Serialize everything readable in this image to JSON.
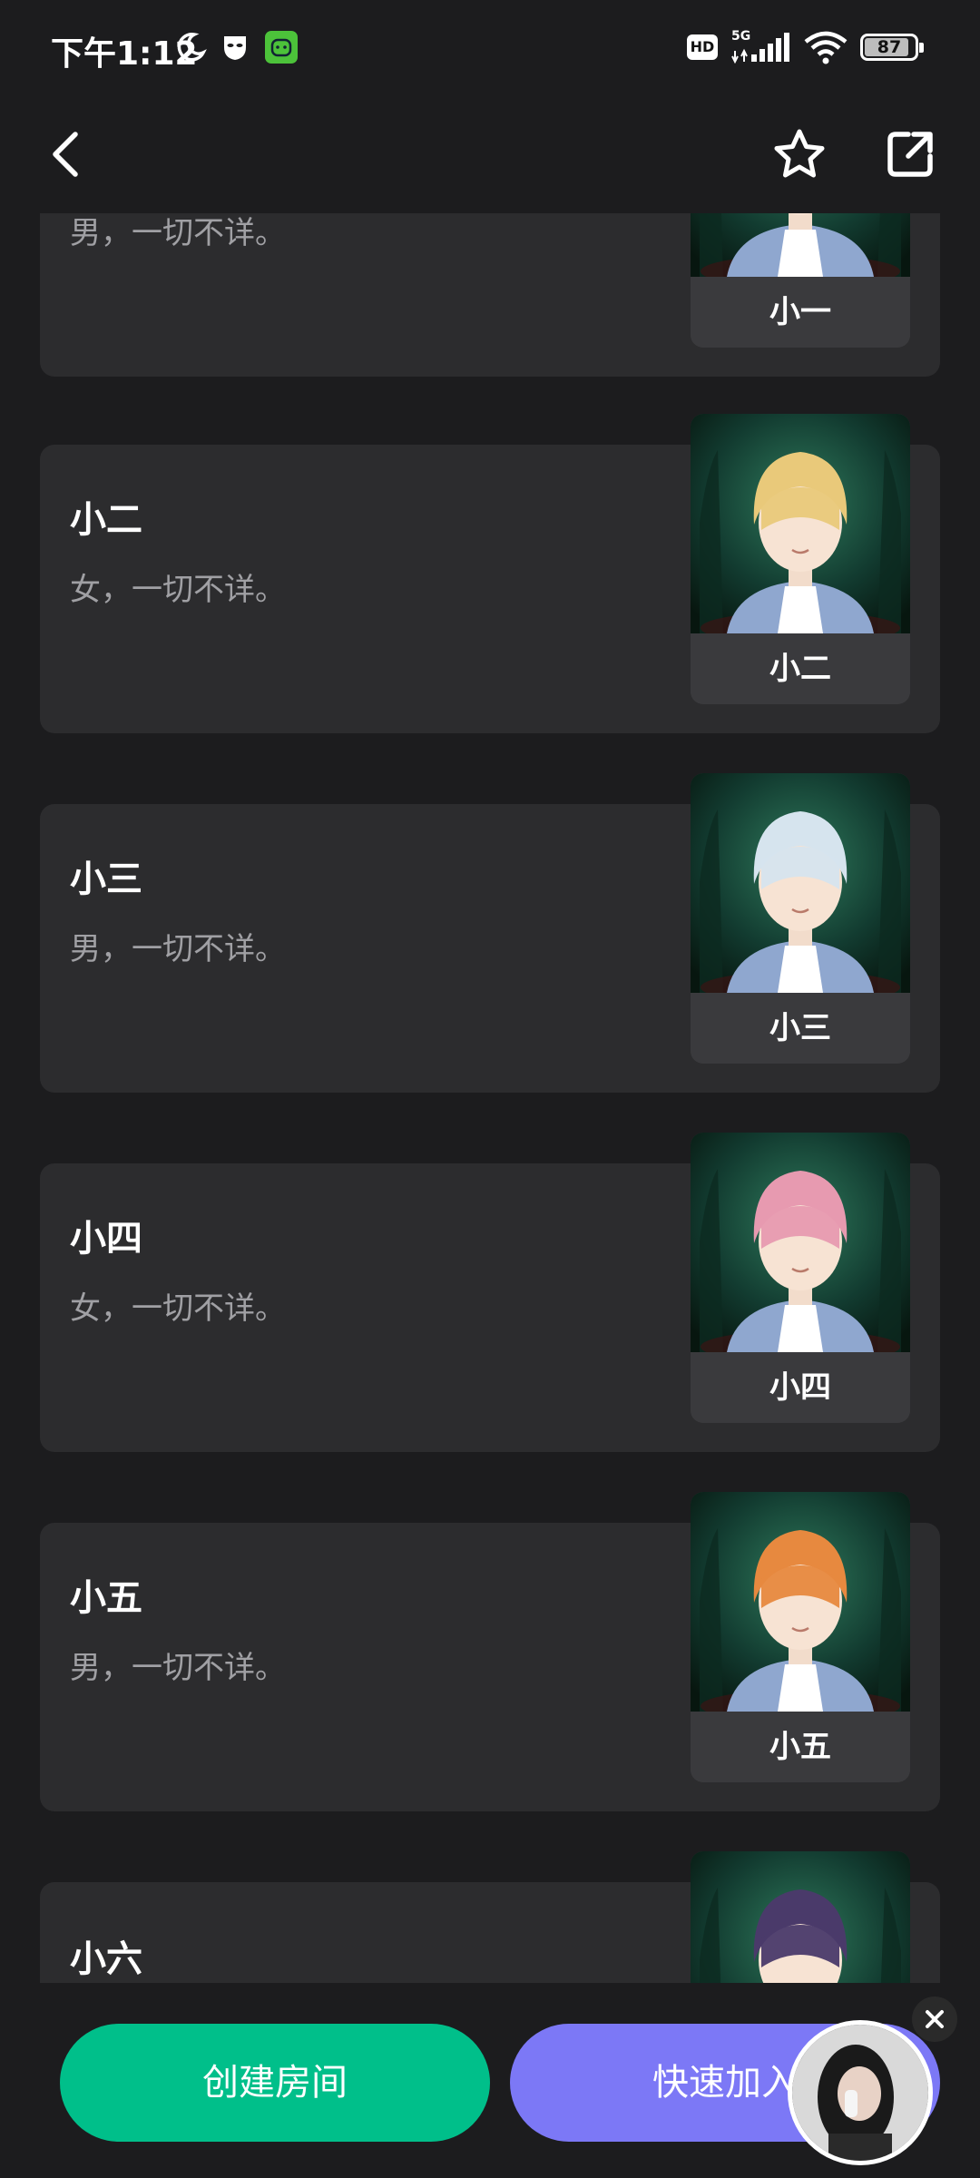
{
  "status_bar": {
    "time": "下午1:12",
    "network": "5G",
    "hd_label": "HD",
    "battery": "87"
  },
  "nav": {
    "back_icon": "chevron-left-icon",
    "favorite_icon": "star-icon",
    "share_icon": "external-link-icon"
  },
  "characters": [
    {
      "name": "小一",
      "desc": "男，一切不详。",
      "hair_color": "#c9a27c"
    },
    {
      "name": "小二",
      "desc": "女，一切不详。",
      "hair_color": "#e9c97a"
    },
    {
      "name": "小三",
      "desc": "男，一切不详。",
      "hair_color": "#d6e4ee"
    },
    {
      "name": "小四",
      "desc": "女，一切不详。",
      "hair_color": "#e79ab0"
    },
    {
      "name": "小五",
      "desc": "男，一切不详。",
      "hair_color": "#e7893f"
    },
    {
      "name": "小六",
      "desc": "",
      "hair_color": "#4a3a6a"
    }
  ],
  "actions": {
    "create_room": "创建房间",
    "quick_join": "快速加入"
  },
  "colors": {
    "create_button": "#00bf8a",
    "join_button": "#7c78f6",
    "card_bg": "#2c2c2e",
    "page_bg": "#1c1c1e"
  }
}
